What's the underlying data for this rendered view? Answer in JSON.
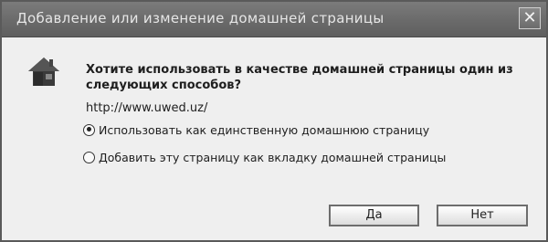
{
  "dialog": {
    "title": "Добавление или изменение домашней страницы",
    "close_glyph": "✕",
    "question": "Хотите использовать в качестве домашней страницы один из следующих способов?",
    "url": "http://www.uwed.uz/",
    "options": [
      {
        "label": "Использовать как единственную домашнюю страницу",
        "selected": true
      },
      {
        "label": "Добавить эту страницу как вкладку домашней страницы",
        "selected": false
      }
    ],
    "buttons": {
      "yes": "Да",
      "no": "Нет"
    },
    "icon": "home-page-icon"
  }
}
